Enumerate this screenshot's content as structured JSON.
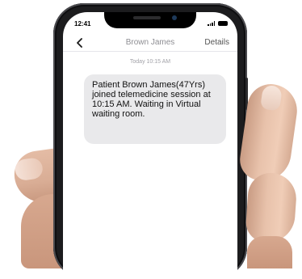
{
  "status_bar": {
    "time": "12:41"
  },
  "nav": {
    "title": "Brown James",
    "details_label": "Details"
  },
  "messages": [
    {
      "timestamp": "Today 10:15 AM",
      "text": "Patient Brown James(47Yrs) joined telemedicine session at 10:15 AM. Waiting in Virtual waiting room."
    }
  ],
  "colors": {
    "accent": "#1a1a1a",
    "bubble": "#e9e9eb",
    "muted": "#8e8e93"
  },
  "icons": {
    "back": "chevron-left-icon",
    "signal": "signal-icon",
    "battery": "battery-icon"
  }
}
